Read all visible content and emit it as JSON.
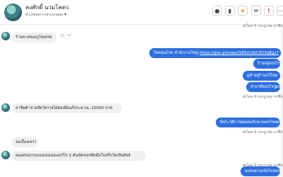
{
  "contact": {
    "name": "คงศักดิ์ นวมโคตร",
    "status": "ตัวเลขสมการประมวลผล",
    "avatar_icon": "user-avatar"
  },
  "header_buttons": [
    {
      "icon": "info-icon",
      "glyph": "●"
    },
    {
      "icon": "trash-icon",
      "glyph": "▮"
    },
    {
      "icon": "star-icon",
      "glyph": "★"
    },
    {
      "icon": "mail-icon",
      "glyph": "✉"
    },
    {
      "icon": "alert-icon",
      "glyph": "!"
    },
    {
      "icon": "more-icon",
      "glyph": "⋯"
    }
  ],
  "stamps": {
    "top": "ส่งโดย 9 กรกฎาคม นาฬิกา 9",
    "mid1": "ส่งโดย 9 กรกฎาคม นาฬิกา 9",
    "mid2": "ส่งโดย 9 กรกฎาคม นาฬิกา 9",
    "bottom": "ส่งโดย 9 กรกฎาคม นาฬิกา 9"
  },
  "messages": {
    "m1": "ร้านขายของภูไทเดรย",
    "m2_prefix": "ไทคลุณไรด สำนักงานใหญ่ ",
    "m2_link": "https://goo.gl/maps/S8SsCdbC8Z3qBgx7",
    "m3": "ร้านอยู่ตรงไร",
    "m4": "ดูคำอยู่ร้านปวิไทต",
    "m5": "ทำยาที่ทอยไรปูดด",
    "m6": "อาชีพค้าขายสัตว์ทรายได้ต่อเดือนก็ประมาณ .15000 บาท",
    "m7": "มีประวัติการผ่อนคอรีกดาทเทรไทลคล",
    "m8": "จอเบื้องเทรา",
    "m9": "ผมอย่ขอกรอบแคปเมลอเลอร์ไร 2 คันบัตรเครดิตมือใจครึ่งวัลปรับศัลล์",
    "m10": "ผมขอดวจุกยังไหลคด"
  },
  "colors": {
    "outgoing_bubble": "#2d6fe0",
    "incoming_bubble": "#f1f0f0",
    "star_button": "#f08a24",
    "alert_button": "#e0332b"
  }
}
